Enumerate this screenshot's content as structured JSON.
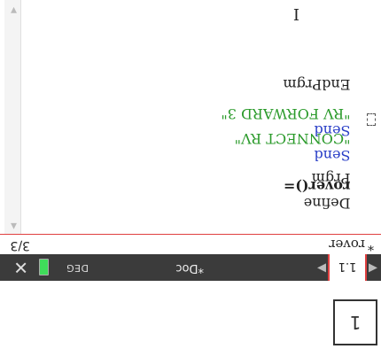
{
  "page_box": {
    "label": "1"
  },
  "tabbar": {
    "nav_left": "◀",
    "active_tab": "1.1",
    "nav_right": "▶",
    "doc_title": "*Doc",
    "mode": "DEG",
    "close": "✕",
    "battery_color": "#3fdc5a"
  },
  "status": {
    "modified_mark": "*",
    "program_name": "rover",
    "line_position": "3/3"
  },
  "editor": {
    "lines": [
      {
        "keyword": "Define",
        "rest": "rover()="
      },
      {
        "keyword": "",
        "rest": "Prgm"
      },
      {
        "keyword": "Send",
        "string": "\"CONNECT RV\""
      },
      {
        "keyword": "Send",
        "string": "\"RV FORWARD 3\""
      },
      {
        "keyword": "",
        "rest": ""
      },
      {
        "keyword": "",
        "rest": "EndPrgm"
      }
    ],
    "text_cursor": "I"
  },
  "colors": {
    "accent": "#e04040",
    "keyword": "#2a3fc7",
    "string": "#2a9a2a",
    "tab_bar": "#3b3b3b"
  }
}
